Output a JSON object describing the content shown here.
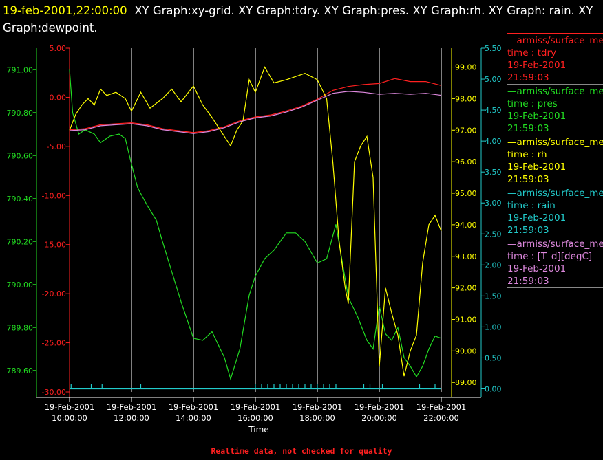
{
  "header": {
    "timestamp": "19-feb-2001,22:00:00",
    "title": "XY Graph:xy-grid.  XY Graph:tdry.  XY Graph:pres.  XY Graph:rh.  XY Graph: rain.  XY Graph:dewpoint."
  },
  "colors": {
    "tdry": "#ff2020",
    "pres": "#22dd22",
    "rh": "#ffff00",
    "rain": "#22cccc",
    "dewpoint": "#dd88dd",
    "grid": "#ffffff",
    "footnote": "#ff2020"
  },
  "legend": [
    {
      "source": "—armiss/surface_me",
      "var": "time : tdry",
      "date": "19-Feb-2001",
      "time": "21:59:03",
      "color": "#ff2020"
    },
    {
      "source": "—armiss/surface_me",
      "var": "time : pres",
      "date": "19-Feb-2001",
      "time": "21:59:03",
      "color": "#22dd22"
    },
    {
      "source": "—armiss/surface_me",
      "var": "time : rh",
      "date": "19-Feb-2001",
      "time": "21:59:03",
      "color": "#ffff00"
    },
    {
      "source": "—armiss/surface_me",
      "var": "time : rain",
      "date": "19-Feb-2001",
      "time": "21:59:03",
      "color": "#22cccc"
    },
    {
      "source": "—armiss/surface_me",
      "var": "time : [T_d][degC]",
      "date": "19-Feb-2001",
      "time": "21:59:03",
      "color": "#dd88dd"
    }
  ],
  "footnote": "Realtime data, not checked for quality",
  "chart_data": {
    "type": "line",
    "xlabel": "Time",
    "x_ticks": [
      {
        "date": "19-Feb-2001",
        "time": "10:00:00",
        "hour": 10
      },
      {
        "date": "19-Feb-2001",
        "time": "12:00:00",
        "hour": 12
      },
      {
        "date": "19-Feb-2001",
        "time": "14:00:00",
        "hour": 14
      },
      {
        "date": "19-Feb-2001",
        "time": "16:00:00",
        "hour": 16
      },
      {
        "date": "19-Feb-2001",
        "time": "18:00:00",
        "hour": 18
      },
      {
        "date": "19-Feb-2001",
        "time": "20:00:00",
        "hour": 20
      },
      {
        "date": "19-Feb-2001",
        "time": "22:00:00",
        "hour": 22
      }
    ],
    "xlim": [
      10,
      22
    ],
    "grid": true,
    "axes": {
      "pres": {
        "ylim": [
          789.5,
          791.1
        ],
        "ticks": [
          "791.00",
          "790.80",
          "790.60",
          "790.40",
          "790.20",
          "790.00",
          "789.80",
          "789.60"
        ],
        "color": "#22dd22"
      },
      "temp": {
        "ylim": [
          -30,
          5
        ],
        "ticks": [
          "5.00",
          "0.00",
          "-5.00",
          "-10.00",
          "-15.00",
          "-20.00",
          "-25.00",
          "-30.00"
        ],
        "color": "#ff2020"
      },
      "rh": {
        "ylim": [
          88.7,
          99.6
        ],
        "ticks": [
          "99.00",
          "98.00",
          "97.00",
          "96.00",
          "95.00",
          "94.00",
          "93.00",
          "92.00",
          "91.00",
          "90.00",
          "89.00"
        ],
        "color": "#ffff00"
      },
      "rain": {
        "ylim": [
          -0.05,
          5.5
        ],
        "ticks": [
          "5.50",
          "5.00",
          "4.50",
          "4.00",
          "3.50",
          "3.00",
          "2.50",
          "2.00",
          "1.50",
          "1.00",
          "0.50",
          "0.00"
        ],
        "color": "#22cccc"
      }
    },
    "series": [
      {
        "name": "tdry",
        "axis": "temp",
        "color": "#ff2020",
        "x": [
          10,
          10.5,
          11,
          11.5,
          12,
          12.5,
          13,
          13.5,
          14,
          14.5,
          15,
          15.5,
          16,
          16.5,
          17,
          17.5,
          18,
          18.5,
          19,
          19.5,
          20,
          20.5,
          21,
          21.5,
          22
        ],
        "y": [
          -3.3,
          -3.2,
          -2.8,
          -2.7,
          -2.6,
          -2.8,
          -3.2,
          -3.4,
          -3.6,
          -3.4,
          -3.0,
          -2.4,
          -2.0,
          -1.8,
          -1.4,
          -0.9,
          -0.2,
          0.7,
          1.1,
          1.3,
          1.4,
          1.9,
          1.6,
          1.6,
          1.2
        ]
      },
      {
        "name": "pres",
        "axis": "pres",
        "color": "#22dd22",
        "x": [
          10,
          10.1,
          10.3,
          10.5,
          10.8,
          11,
          11.3,
          11.6,
          11.8,
          12,
          12.2,
          12.5,
          12.8,
          13,
          13.3,
          13.6,
          14,
          14.3,
          14.6,
          15,
          15.2,
          15.5,
          15.8,
          16,
          16.3,
          16.6,
          17,
          17.3,
          17.6,
          18,
          18.3,
          18.6,
          19,
          19.3,
          19.6,
          19.8,
          20,
          20.2,
          20.4,
          20.6,
          20.8,
          21,
          21.2,
          21.4,
          21.6,
          21.8,
          22
        ],
        "y": [
          791.0,
          790.8,
          790.7,
          790.72,
          790.7,
          790.66,
          790.69,
          790.7,
          790.68,
          790.56,
          790.45,
          790.37,
          790.3,
          790.2,
          790.06,
          789.92,
          789.75,
          789.74,
          789.78,
          789.66,
          789.56,
          789.7,
          789.95,
          790.04,
          790.12,
          790.16,
          790.24,
          790.24,
          790.2,
          790.1,
          790.12,
          790.28,
          789.94,
          789.85,
          789.74,
          789.7,
          789.9,
          789.77,
          789.74,
          789.8,
          789.66,
          789.62,
          789.57,
          789.62,
          789.7,
          789.76,
          789.75
        ]
      },
      {
        "name": "rh",
        "axis": "rh",
        "color": "#ffff00",
        "x": [
          10,
          10.2,
          10.4,
          10.6,
          10.8,
          11,
          11.2,
          11.5,
          11.8,
          12,
          12.3,
          12.6,
          13,
          13.3,
          13.6,
          14,
          14.3,
          14.6,
          15,
          15.2,
          15.4,
          15.6,
          15.8,
          16,
          16.3,
          16.6,
          17,
          17.3,
          17.6,
          18,
          18.3,
          18.5,
          18.7,
          18.9,
          19,
          19.2,
          19.4,
          19.6,
          19.8,
          20,
          20.2,
          20.4,
          20.6,
          20.8,
          21,
          21.2,
          21.4,
          21.6,
          21.8,
          22
        ],
        "y": [
          97.0,
          97.5,
          97.8,
          98.0,
          97.8,
          98.3,
          98.1,
          98.2,
          98.0,
          97.6,
          98.2,
          97.7,
          98.0,
          98.3,
          97.9,
          98.4,
          97.8,
          97.4,
          96.8,
          96.5,
          97.0,
          97.3,
          98.6,
          98.2,
          99.0,
          98.5,
          98.6,
          98.7,
          98.8,
          98.6,
          98.0,
          96.0,
          93.5,
          92.0,
          91.5,
          96.0,
          96.5,
          96.8,
          95.5,
          89.5,
          92.0,
          91.2,
          90.5,
          89.2,
          90.0,
          90.5,
          92.8,
          94.0,
          94.3,
          93.8
        ]
      },
      {
        "name": "rain",
        "axis": "rain",
        "color": "#22cccc",
        "x": [
          10.05,
          10.7,
          11.05,
          12.3,
          16.0,
          16.2,
          16.4,
          16.6,
          16.8,
          17.0,
          17.2,
          17.4,
          17.6,
          17.8,
          18.0,
          18.2,
          18.4,
          18.6,
          19.5,
          19.7,
          20.1,
          21.3,
          21.8
        ],
        "y": [
          0.08,
          0.08,
          0.08,
          0.08,
          0.08,
          0.08,
          0.08,
          0.08,
          0.08,
          0.08,
          0.08,
          0.08,
          0.08,
          0.08,
          0.08,
          0.08,
          0.08,
          0.08,
          0.08,
          0.08,
          0.08,
          0.08,
          0.08
        ]
      },
      {
        "name": "dewpoint",
        "axis": "temp",
        "color": "#dd88dd",
        "x": [
          10,
          10.5,
          11,
          11.5,
          12,
          12.5,
          13,
          13.5,
          14,
          14.5,
          15,
          15.5,
          16,
          16.5,
          17,
          17.5,
          18,
          18.5,
          19,
          19.5,
          20,
          20.5,
          21,
          21.5,
          22
        ],
        "y": [
          -3.4,
          -3.3,
          -2.9,
          -2.8,
          -2.7,
          -2.9,
          -3.3,
          -3.5,
          -3.7,
          -3.5,
          -3.1,
          -2.5,
          -2.1,
          -1.9,
          -1.5,
          -1.0,
          -0.3,
          0.4,
          0.6,
          0.5,
          0.3,
          0.4,
          0.3,
          0.4,
          0.2
        ]
      }
    ]
  }
}
